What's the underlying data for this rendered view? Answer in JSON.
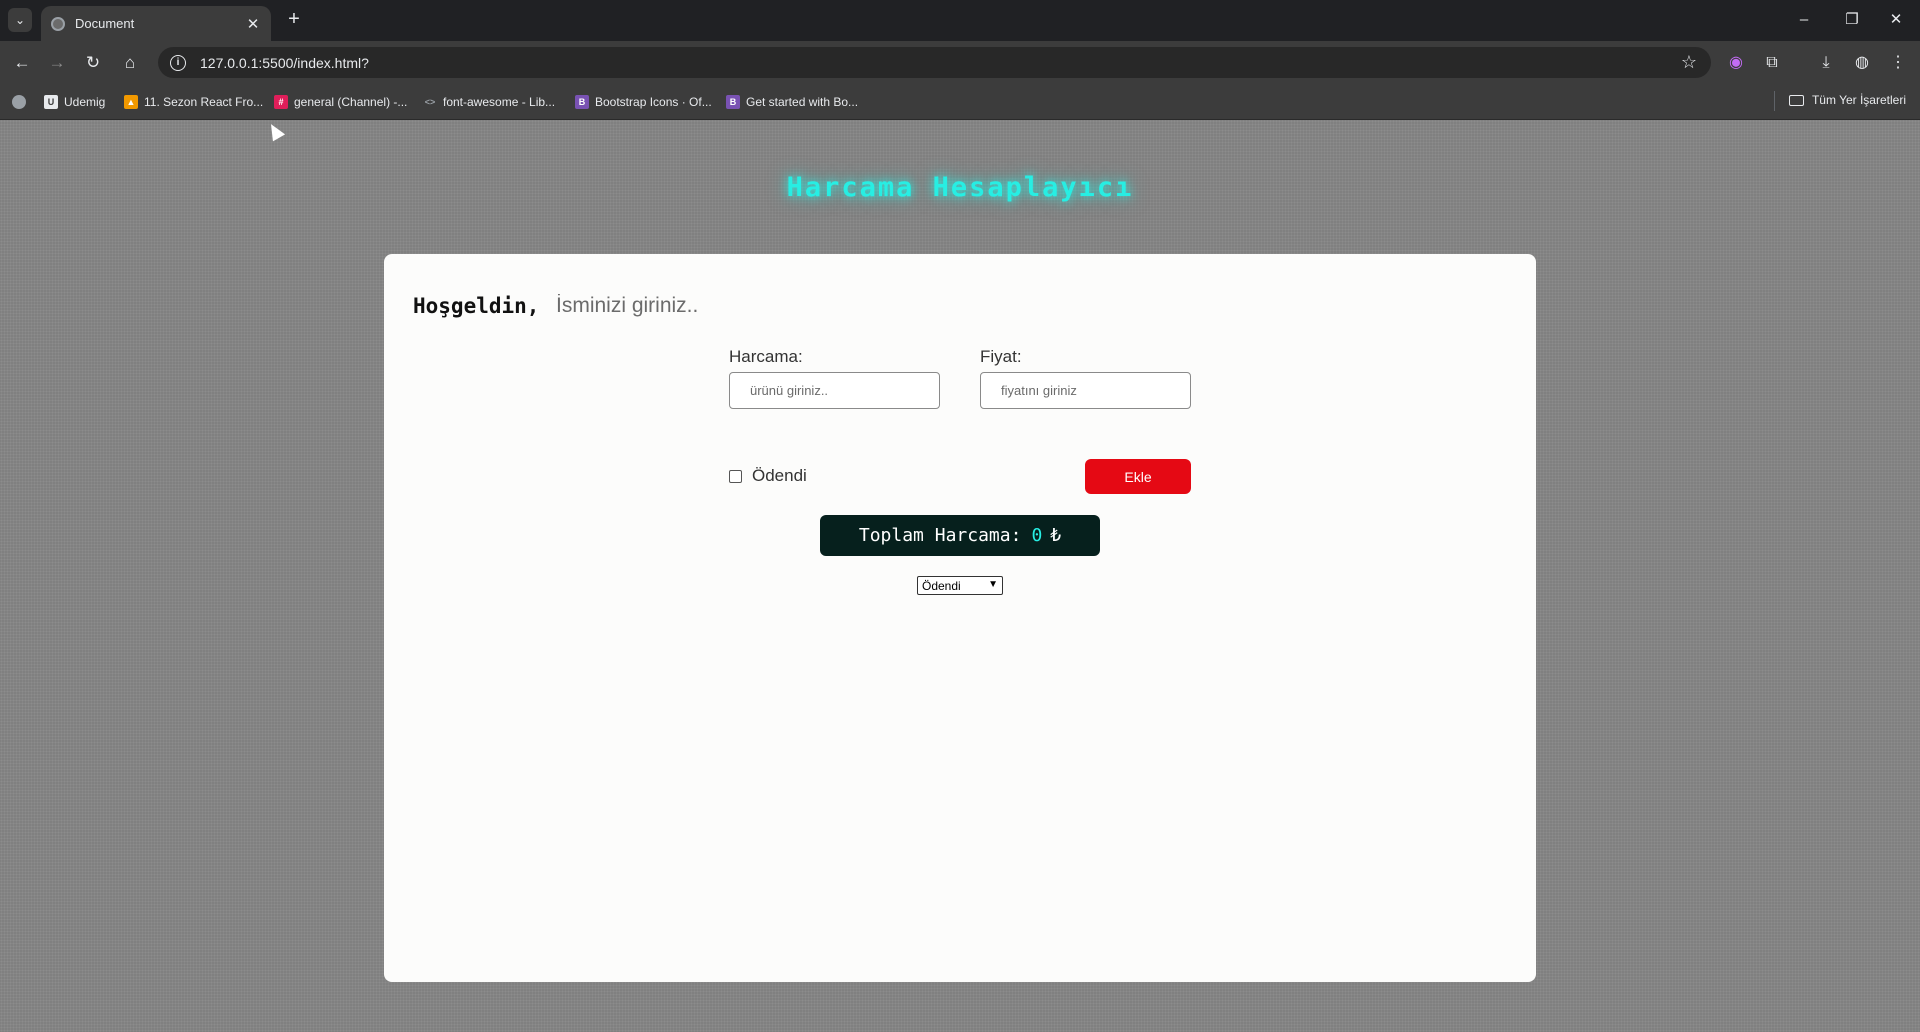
{
  "browser": {
    "tab_title": "Document",
    "url": "127.0.0.1:5500/index.html?",
    "bookmarks": [
      {
        "label": "Udemig",
        "color": "#e8eaed"
      },
      {
        "label": "11. Sezon React Fro...",
        "color": "#f29900"
      },
      {
        "label": "general (Channel) -...",
        "color": "#e01e5a"
      },
      {
        "label": "font-awesome - Lib...",
        "color": "#9aa0a6"
      },
      {
        "label": "Bootstrap Icons · Of...",
        "color": "#7952b3"
      },
      {
        "label": "Get started with Bo...",
        "color": "#7952b3"
      }
    ],
    "bookmarks_folder": "Tüm Yer İşaretleri"
  },
  "app": {
    "title": "Harcama Hesaplayıcı",
    "welcome": "Hoşgeldin,",
    "name_placeholder": "İsminizi giriniz..",
    "expense_label": "Harcama:",
    "expense_placeholder": "ürünü giriniz..",
    "price_label": "Fiyat:",
    "price_placeholder": "fiyatını giriniz",
    "paid_label": "Ödendi",
    "add_button": "Ekle",
    "total_label": "Toplam Harcama:",
    "total_amount": "0",
    "currency": "₺",
    "filter_selected": "Ödendi"
  },
  "colors": {
    "accent_cyan": "#27eee3",
    "button_red": "#e50914",
    "total_bg": "#06201d"
  }
}
